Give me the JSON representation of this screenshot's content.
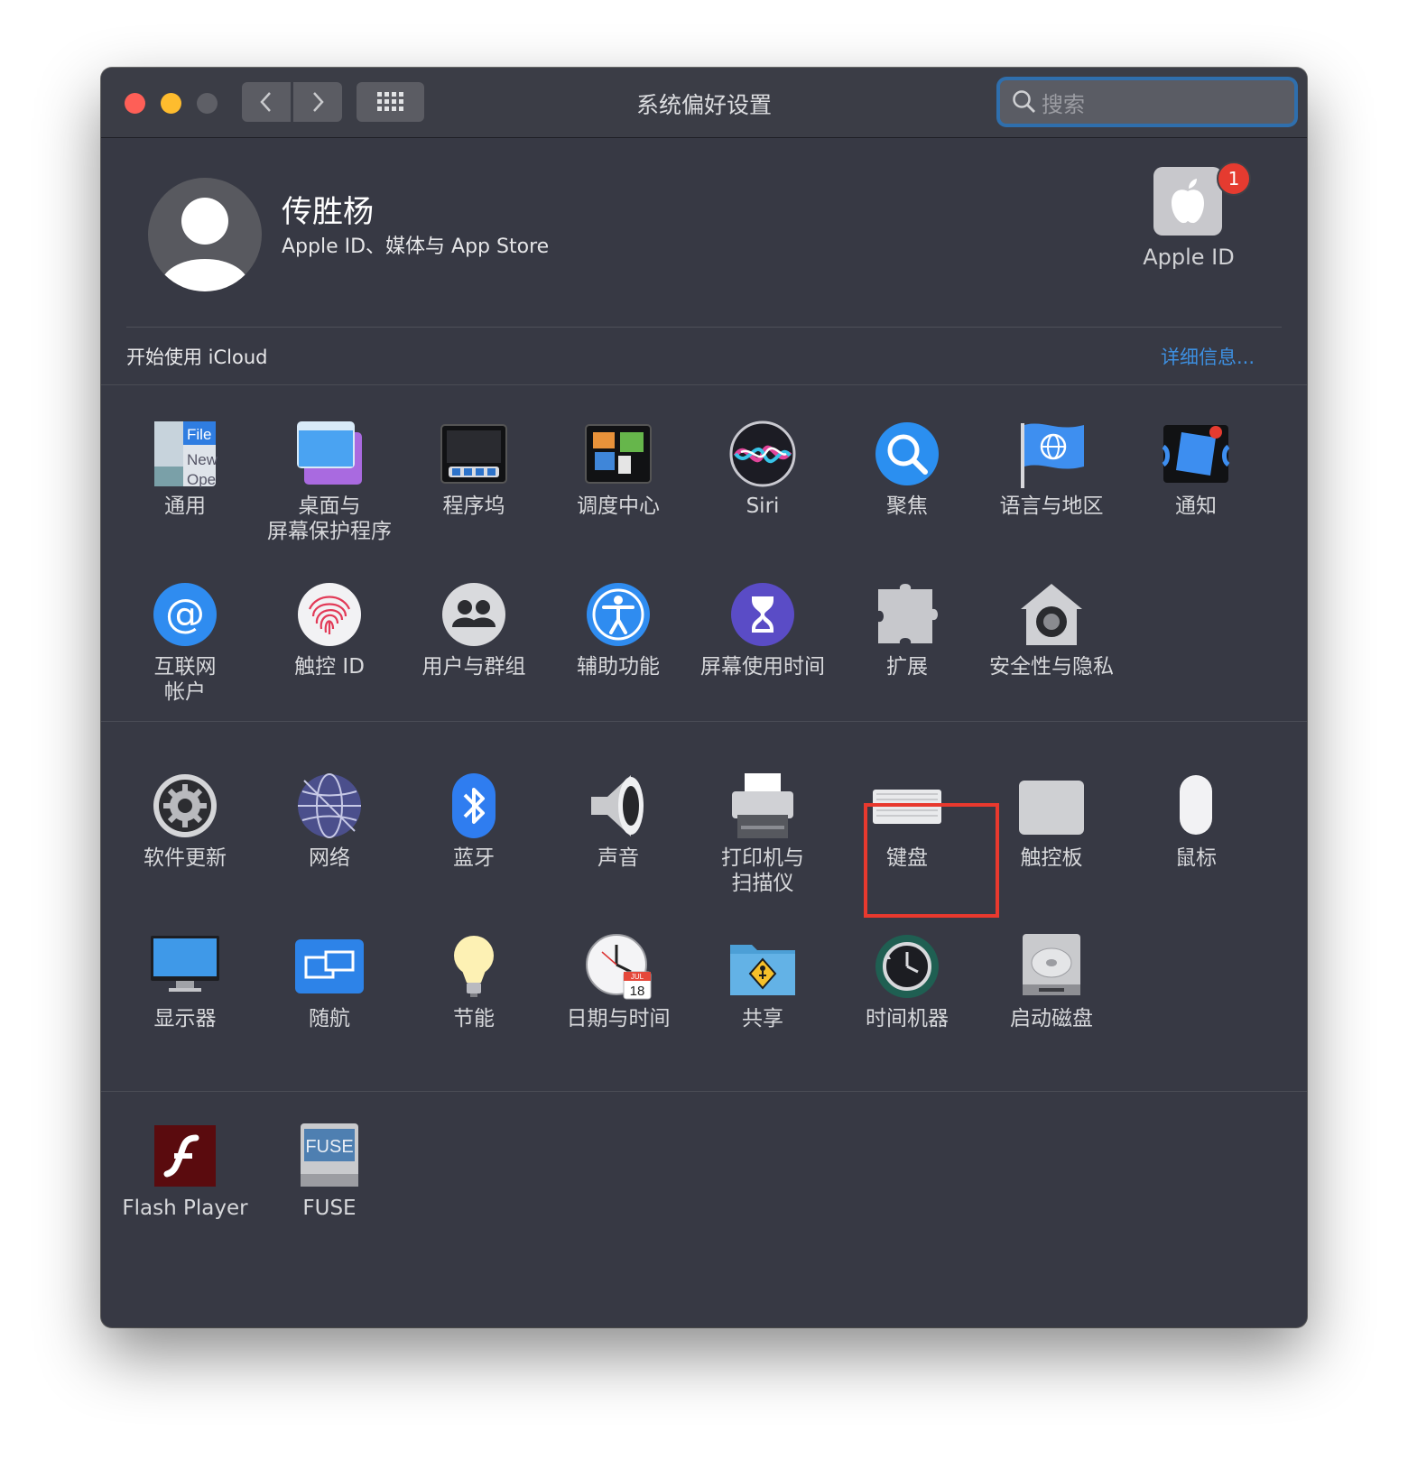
{
  "window": {
    "title": "系统偏好设置"
  },
  "search": {
    "placeholder": "搜索"
  },
  "user": {
    "name": "传胜杨",
    "subtitle": "Apple ID、媒体与 App Store"
  },
  "apple_id": {
    "label": "Apple ID",
    "badge": "1"
  },
  "icloud": {
    "text": "开始使用 iCloud",
    "link": "详细信息..."
  },
  "row1": [
    {
      "label1": "通用",
      "label2": ""
    },
    {
      "label1": "桌面与",
      "label2": "屏幕保护程序"
    },
    {
      "label1": "程序坞",
      "label2": ""
    },
    {
      "label1": "调度中心",
      "label2": ""
    },
    {
      "label1": "Siri",
      "label2": ""
    },
    {
      "label1": "聚焦",
      "label2": ""
    },
    {
      "label1": "语言与地区",
      "label2": ""
    },
    {
      "label1": "通知",
      "label2": ""
    }
  ],
  "row2": [
    {
      "label1": "互联网",
      "label2": "帐户"
    },
    {
      "label1": "触控 ID",
      "label2": ""
    },
    {
      "label1": "用户与群组",
      "label2": ""
    },
    {
      "label1": "辅助功能",
      "label2": ""
    },
    {
      "label1": "屏幕使用时间",
      "label2": ""
    },
    {
      "label1": "扩展",
      "label2": ""
    },
    {
      "label1": "安全性与隐私",
      "label2": ""
    }
  ],
  "row3": [
    {
      "label1": "软件更新",
      "label2": ""
    },
    {
      "label1": "网络",
      "label2": ""
    },
    {
      "label1": "蓝牙",
      "label2": ""
    },
    {
      "label1": "声音",
      "label2": ""
    },
    {
      "label1": "打印机与",
      "label2": "扫描仪"
    },
    {
      "label1": "键盘",
      "label2": ""
    },
    {
      "label1": "触控板",
      "label2": ""
    },
    {
      "label1": "鼠标",
      "label2": ""
    }
  ],
  "row4": [
    {
      "label1": "显示器",
      "label2": ""
    },
    {
      "label1": "随航",
      "label2": ""
    },
    {
      "label1": "节能",
      "label2": ""
    },
    {
      "label1": "日期与时间",
      "label2": ""
    },
    {
      "label1": "共享",
      "label2": ""
    },
    {
      "label1": "时间机器",
      "label2": ""
    },
    {
      "label1": "启动磁盘",
      "label2": ""
    }
  ],
  "row5": [
    {
      "label1": "Flash Player",
      "label2": ""
    },
    {
      "label1": "FUSE",
      "label2": ""
    }
  ],
  "icon_text": {
    "general_file": "File",
    "general_new": "New",
    "general_open": "Ope",
    "fuse": "FUSE",
    "calendar_month": "JUL",
    "calendar_day": "18"
  },
  "colors": {
    "accent": "#3d8fe0",
    "window_bg": "#373944",
    "highlight": "#e8392e",
    "badge": "#e53b30"
  }
}
